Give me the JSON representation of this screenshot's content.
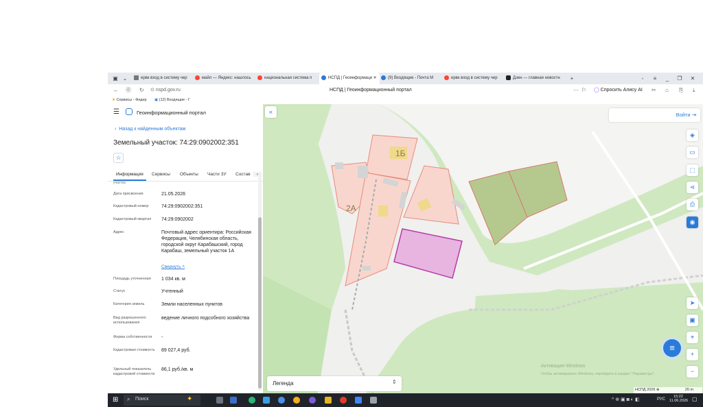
{
  "browser": {
    "tabs": [
      {
        "label": "ервк вход в систему чер",
        "color": "#777777"
      },
      {
        "label": "майл — Яндекс: нашлось",
        "color": "#ff4433"
      },
      {
        "label": "национальная система п",
        "color": "#ff4433"
      },
      {
        "label": "НСПД | Геоинформаци",
        "color": "#2a7bd8",
        "active": true
      },
      {
        "label": "(9) Входящие - Почта М",
        "color": "#2a7bd8"
      },
      {
        "label": "ервк вход в систему чер",
        "color": "#ff4433"
      },
      {
        "label": "Дзен — главная новостн",
        "color": "#222222"
      }
    ],
    "url": "nspd.gov.ru",
    "page_title": "НСПД | Геоинформационный портал",
    "alice": "Спросить Алису AI",
    "bookmarks": [
      "Сервисы - Федер",
      "(12) Входящие - Г"
    ]
  },
  "panel": {
    "portal_title": "Геоинформационный портал",
    "back_link": "Назад к найденным объектам",
    "object_title": "Земельный участок: 74:29:0902002:351",
    "tabs": [
      "Информация",
      "Сервисы",
      "Объекты",
      "Части ЗУ",
      "Состав"
    ],
    "cut_label": "участка",
    "rows": [
      {
        "label": "Дата присвоения",
        "value": "21.05.2026"
      },
      {
        "label": "Кадастровый номер",
        "value": "74:29:0902002:351"
      },
      {
        "label": "Кадастровый квартал",
        "value": "74:29:0902002"
      },
      {
        "label": "Адрес",
        "value": "Почтовый адрес ориентира: Российская Федерация, Челябинская область, городской округ Карабашский, город Карабаш, земельный участок 1А"
      },
      {
        "label": "Площадь уточненная",
        "value": "1 034 кв. м"
      },
      {
        "label": "Статус",
        "value": "Учтенный"
      },
      {
        "label": "Категория земель",
        "value": "Земли населенных пунктов"
      },
      {
        "label": "Вид разрешенного использования",
        "value": "ведение личного подсобного хозяйства"
      },
      {
        "label": "Форма собственности",
        "value": "-"
      },
      {
        "label": "Кадастровая стоимость",
        "value": "89 027,4 руб."
      },
      {
        "label": "Удельный показатель кадастровой стоимости",
        "value": "86,1 руб./кв. м"
      }
    ],
    "services_link": "Свернуть"
  },
  "map": {
    "login": "Войти",
    "legend": "Легенда",
    "labels": [
      "1Б",
      "2А"
    ],
    "copyright": "НСПД 2026",
    "scale": "20 m",
    "watermark_1": "Активация Windows",
    "watermark_2": "Чтобы активировать Windows, перейдите в раздел \"Параметры\"."
  },
  "taskbar": {
    "search": "Поиск",
    "lang": "РУС",
    "time": "15:22",
    "date": "11.06.2026"
  }
}
